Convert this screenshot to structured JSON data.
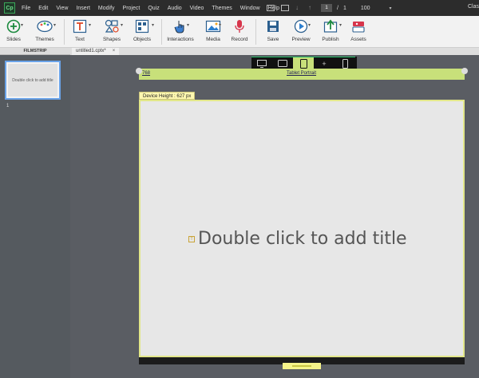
{
  "app": {
    "logo": "Cp",
    "mode_label": "Clas"
  },
  "menu": [
    "File",
    "Edit",
    "View",
    "Insert",
    "Modify",
    "Project",
    "Quiz",
    "Audio",
    "Video",
    "Themes",
    "Window",
    "Help"
  ],
  "menu_tools": {
    "page_current": "1",
    "page_sep": "/",
    "page_total": "1",
    "zoom": "100"
  },
  "toolbar": {
    "slides": "Slides",
    "themes": "Themes",
    "text": "Text",
    "shapes": "Shapes",
    "objects": "Objects",
    "interactions": "Interactions",
    "media": "Media",
    "record": "Record",
    "save": "Save",
    "preview": "Preview",
    "publish": "Publish",
    "assets": "Assets"
  },
  "filmstrip": {
    "header": "FILMSTRIP",
    "thumb_text": "Double click to add title",
    "slide_number": "1"
  },
  "tab": {
    "name": "untitled1.cptx*",
    "close": "×"
  },
  "stage": {
    "ruler_left": "768",
    "ruler_center": "Tablet Portrait",
    "device_height": "Device Height : 627 px",
    "placeholder_title": "Double click to add title"
  },
  "colors": {
    "accent": "#c8e07a",
    "menubar": "#2c2c2c",
    "stage": "#5a5d63",
    "selection": "#6aa3e8"
  }
}
